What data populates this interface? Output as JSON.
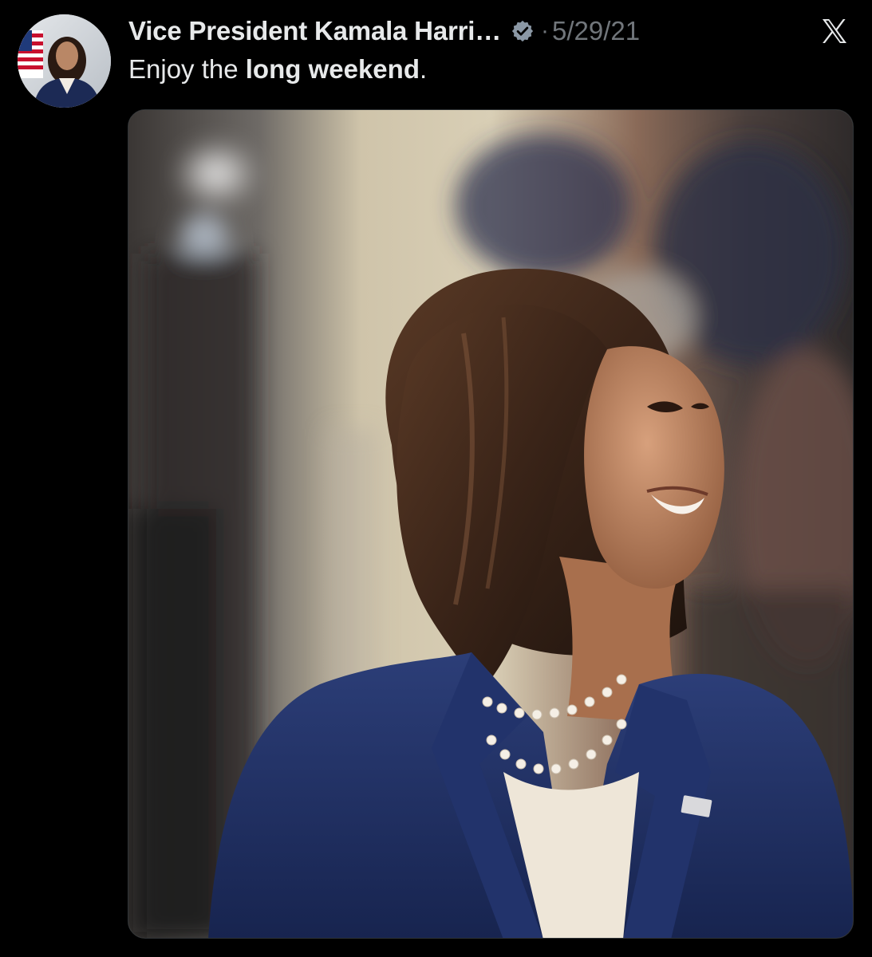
{
  "tweet": {
    "author": {
      "display_name": "Vice President Kamala Harri…",
      "verified_icon": "verified-badge-icon",
      "avatar_icon": "profile-avatar"
    },
    "separator": "·",
    "timestamp": "5/29/21",
    "text_prefix": "Enjoy the ",
    "text_bold": "long weekend",
    "text_suffix": ".",
    "platform_icon": "x-logo-icon",
    "media": {
      "kind": "photo",
      "subject": "portrait-photo"
    }
  },
  "colors": {
    "background": "#000000",
    "text_primary": "#e7e9ea",
    "text_secondary": "#71767b",
    "verified": "#8b98a5"
  }
}
